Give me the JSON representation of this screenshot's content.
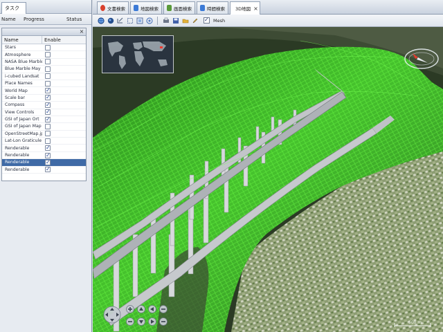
{
  "left_panel": {
    "tab_label": "タスク",
    "columns": [
      "Name",
      "Progress",
      "Status"
    ]
  },
  "layer_panel": {
    "close_glyph": "×",
    "header_name": "Name",
    "header_enable": "Enable",
    "layers": [
      {
        "name": "Stars",
        "enabled": false
      },
      {
        "name": "Atmosphere",
        "enabled": false
      },
      {
        "name": "NASA Blue Marble",
        "enabled": false
      },
      {
        "name": "Blue Marble May",
        "enabled": false
      },
      {
        "name": "i-cubed Landsat",
        "enabled": false
      },
      {
        "name": "Place Names",
        "enabled": false
      },
      {
        "name": "World Map",
        "enabled": true
      },
      {
        "name": "Scale bar",
        "enabled": true
      },
      {
        "name": "Compass",
        "enabled": true
      },
      {
        "name": "View Controls",
        "enabled": true
      },
      {
        "name": "GSI of Japan Ort",
        "enabled": true
      },
      {
        "name": "GSI of Japan Map",
        "enabled": false
      },
      {
        "name": "OpenStreetMap.jp",
        "enabled": false
      },
      {
        "name": "Lat-Lon Graticule",
        "enabled": false
      },
      {
        "name": "Renderable",
        "enabled": true
      },
      {
        "name": "Renderable",
        "enabled": true
      },
      {
        "name": "Renderable",
        "enabled": true,
        "selected": true
      },
      {
        "name": "Renderable",
        "enabled": true
      }
    ]
  },
  "tabs": [
    {
      "label": "文書検索",
      "icon_color": "#d9412e",
      "active": false
    },
    {
      "label": "地図検索",
      "icon_color": "#3c7ad6",
      "active": false
    },
    {
      "label": "画面検索",
      "icon_color": "#5a9a3a",
      "active": false
    },
    {
      "label": "時間検索",
      "icon_color": "#3c7ad6",
      "active": false
    },
    {
      "label": "3D地図",
      "icon_color": "#3c7ad6",
      "active": true,
      "close": "×"
    }
  ],
  "toolbar": {
    "mesh_label": "Mesh",
    "icons": [
      "globe-icon",
      "globe-dark-icon",
      "pan-icon",
      "select-icon",
      "zoom-region-icon",
      "layers-icon",
      "print-icon",
      "save-icon",
      "folder-icon",
      "edit-icon"
    ]
  },
  "viewport": {
    "scale_label": "500 m",
    "colors": {
      "terrain_green": "#3bbf2a",
      "mesh_line": "#5cff3e",
      "bridge_deck": "#bfc2c6",
      "pier": "#d7d9dc",
      "valley": "#6c7a58",
      "sky_dark": "#24301f"
    }
  }
}
